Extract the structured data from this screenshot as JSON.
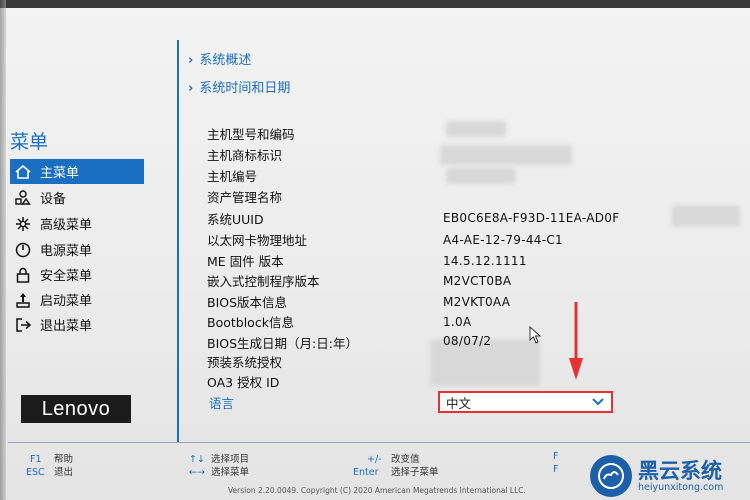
{
  "sidebar": {
    "title": "菜单",
    "items": [
      {
        "label": "主菜单",
        "icon": "home-icon"
      },
      {
        "label": "设备",
        "icon": "devices-icon"
      },
      {
        "label": "高级菜单",
        "icon": "advanced-icon"
      },
      {
        "label": "电源菜单",
        "icon": "power-icon"
      },
      {
        "label": "安全菜单",
        "icon": "lock-icon"
      },
      {
        "label": "启动菜单",
        "icon": "boot-icon"
      },
      {
        "label": "退出菜单",
        "icon": "exit-icon"
      }
    ],
    "logo": "Lenovo"
  },
  "top_links": [
    "系统概述",
    "系统时间和日期"
  ],
  "info_rows": [
    {
      "label": "主机型号和编码",
      "value": ""
    },
    {
      "label": "主机商标标识",
      "value": ""
    },
    {
      "label": "主机编号",
      "value": ""
    },
    {
      "label": "资产管理名称",
      "value": ""
    },
    {
      "label": "系统UUID",
      "value": "EB0C6E8A-F93D-11EA-AD0F"
    },
    {
      "label": "以太网卡物理地址",
      "value": "A4-AE-12-79-44-C1"
    },
    {
      "label": "ME 固件 版本",
      "value": "14.5.12.1111"
    },
    {
      "label": "嵌入式控制程序版本",
      "value": "M2VCT0BA"
    },
    {
      "label": "BIOS版本信息",
      "value": "M2VKT0AA"
    },
    {
      "label": "Bootblock信息",
      "value": "1.0A"
    },
    {
      "label": "BIOS生成日期（月:日:年）",
      "value": "08/07/2"
    },
    {
      "label": "预装系统授权",
      "value": ""
    },
    {
      "label": "OA3 授权 ID",
      "value": ""
    }
  ],
  "language": {
    "label": "语言",
    "value": "中文"
  },
  "footer": {
    "hints": [
      {
        "key": "F1",
        "text": "帮助"
      },
      {
        "key": "ESC",
        "text": "退出"
      },
      {
        "key": "↑↓",
        "text": "选择项目"
      },
      {
        "key": "←→",
        "text": "选择菜单"
      },
      {
        "key": "+/-",
        "text": "改变值"
      },
      {
        "key": "Enter",
        "text": "选择子菜单"
      },
      {
        "key": "F",
        "text": ""
      },
      {
        "key": "F",
        "text": ""
      }
    ],
    "version": "Version 2.20.0049. Copyright (C) 2020 American Megatrends International LLC."
  },
  "watermark": {
    "title": "黑云系统",
    "url": "heiyunxitong.com"
  },
  "colors": {
    "accent": "#1b6fc0",
    "highlight": "#e53333",
    "background": "#eeeeee"
  }
}
